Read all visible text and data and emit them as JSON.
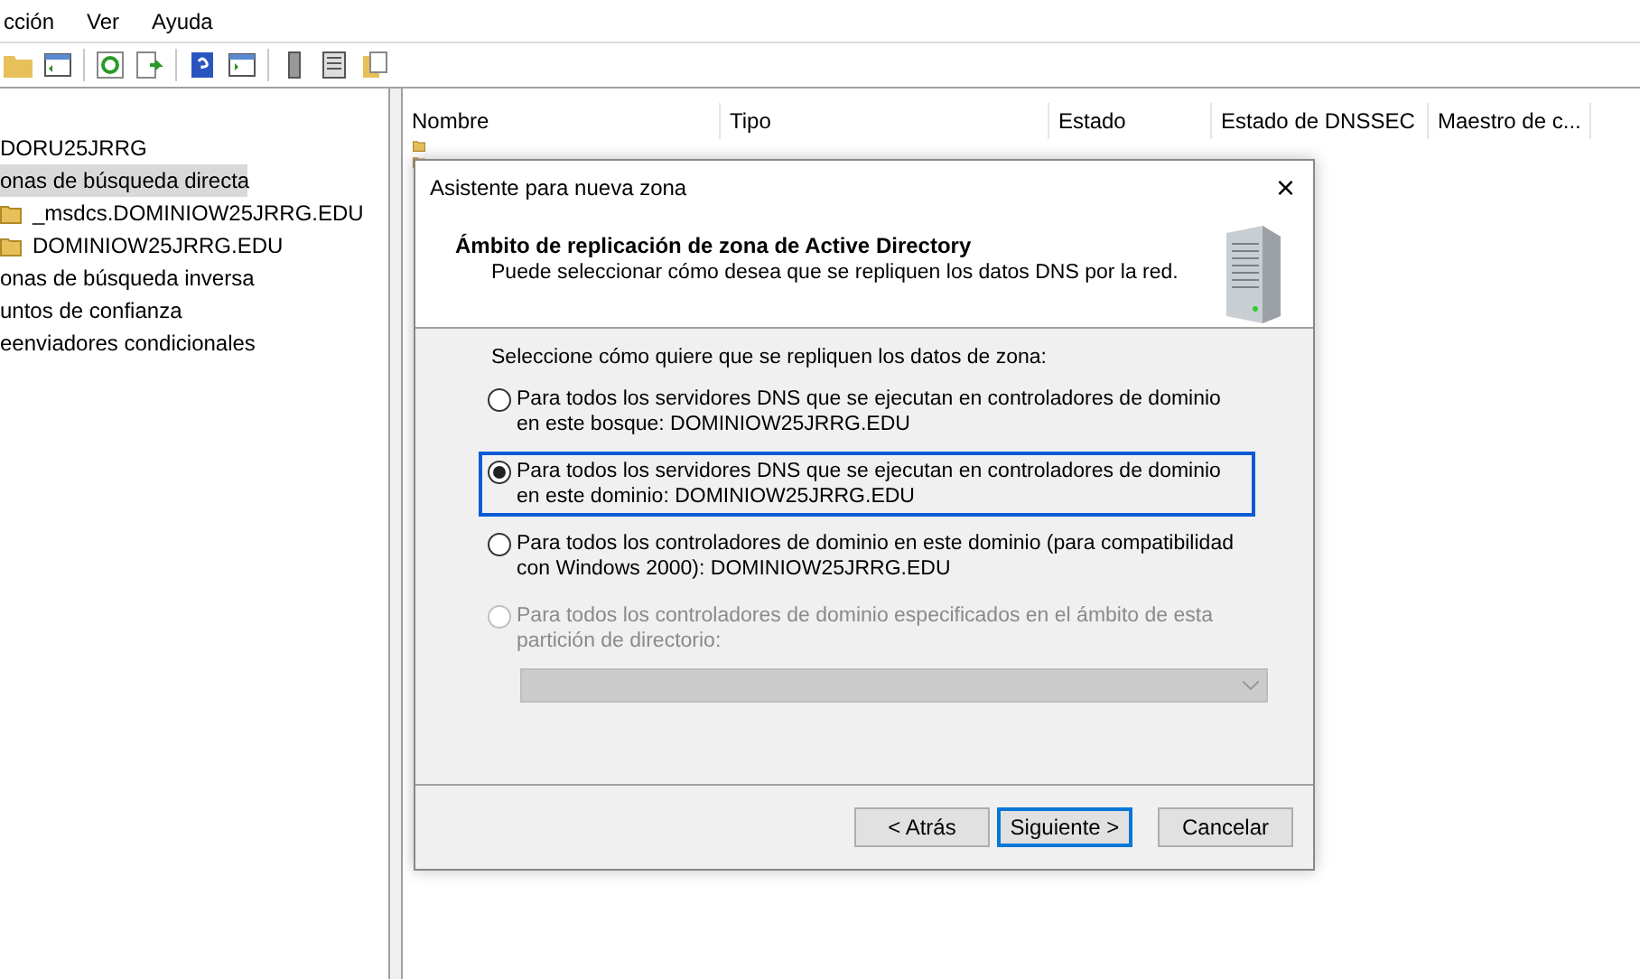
{
  "menu": [
    "cción",
    "Ver",
    "Ayuda"
  ],
  "tree": [
    {
      "label": "DORU25JRRG",
      "selected": false,
      "folder": false
    },
    {
      "label": "onas de búsqueda directa",
      "selected": true,
      "folder": false
    },
    {
      "label": "_msdcs.DOMINIOW25JRRG.EDU",
      "selected": false,
      "folder": true
    },
    {
      "label": "DOMINIOW25JRRG.EDU",
      "selected": false,
      "folder": true
    },
    {
      "label": "onas de búsqueda inversa",
      "selected": false,
      "folder": false
    },
    {
      "label": "untos de confianza",
      "selected": false,
      "folder": false
    },
    {
      "label": "eenviadores condicionales",
      "selected": false,
      "folder": false
    }
  ],
  "list": {
    "columns": [
      "Nombre",
      "Tipo",
      "Estado",
      "Estado de DNSSEC",
      "Maestro de c..."
    ]
  },
  "dialog": {
    "title": "Asistente para nueva zona",
    "close": "×",
    "heading": "Ámbito de replicación de zona de Active Directory",
    "subheading": "Puede seleccionar cómo desea que se repliquen los datos DNS por la red.",
    "prompt": "Seleccione cómo quiere que se repliquen los datos de zona:",
    "options": [
      {
        "label": "Para todos los servidores DNS que se ejecutan en controladores de dominio en este bosque: DOMINIOW25JRRG.EDU",
        "selected": false,
        "disabled": false
      },
      {
        "label": "Para todos los servidores DNS que se ejecutan en controladores de dominio en este dominio: DOMINIOW25JRRG.EDU",
        "selected": true,
        "disabled": false
      },
      {
        "label": "Para todos los controladores de dominio en este dominio (para compatibilidad con Windows 2000): DOMINIOW25JRRG.EDU",
        "selected": false,
        "disabled": false
      },
      {
        "label": "Para todos los controladores de dominio especificados en el ámbito de esta partición de directorio:",
        "selected": false,
        "disabled": true
      }
    ],
    "dropdown": {
      "disabled": true
    },
    "buttons": [
      {
        "label": "< Atrás",
        "default": false
      },
      {
        "label": "Siguiente >",
        "default": true
      },
      {
        "label": "Cancelar",
        "default": false
      }
    ]
  }
}
